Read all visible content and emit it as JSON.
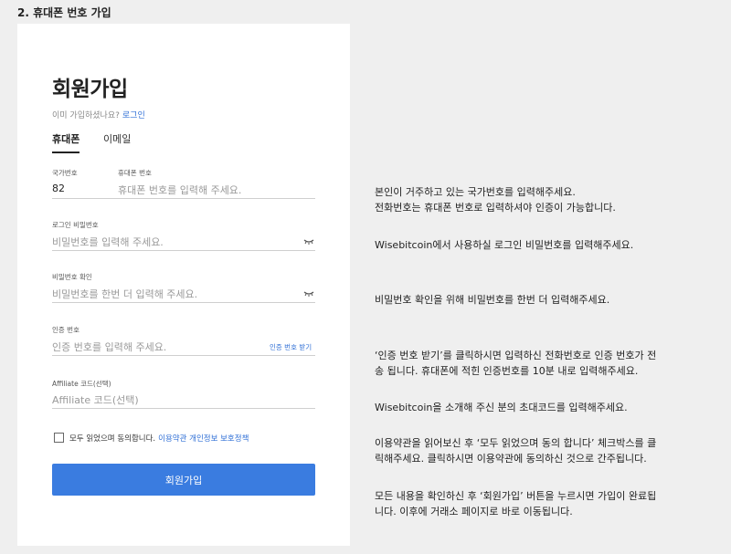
{
  "section_title": "2. 휴대폰 번호 가입",
  "form": {
    "title": "회원가입",
    "already_text": "이미 가입하셨나요?",
    "login_link": "로그인",
    "tabs": [
      {
        "label": "휴대폰",
        "active": true
      },
      {
        "label": "이메일",
        "active": false
      }
    ],
    "country_label": "국가번호",
    "country_value": "82",
    "phone_label": "휴대폰 번호",
    "phone_placeholder": "휴대폰 번호를 입력해 주세요.",
    "password_label": "로그인 비밀번호",
    "password_placeholder": "비밀번호를 입력해 주세요.",
    "password_confirm_label": "비밀번호 확인",
    "password_confirm_placeholder": "비밀번호를 한번 더 입력해 주세요.",
    "verify_label": "인증 번호",
    "verify_placeholder": "인증 번호를 입력해 주세요.",
    "verify_link": "인증 번호 받기",
    "affiliate_label": "Affiliate 코드(선택)",
    "affiliate_placeholder": "Affiliate 코드(선택)",
    "agree_text": "모두 읽었으며 동의합니다.",
    "terms_link": "이용약관 개인정보 보호정책",
    "submit_label": "회원가입"
  },
  "descriptions": {
    "country_line1": "본인이 거주하고 있는 국가번호를 입력해주세요.",
    "country_line2": "전화번호는 휴대폰 번호로 입력하셔야 인증이 가능합니다.",
    "password": "Wisebitcoin에서 사용하실 로그인 비밀번호를 입력해주세요.",
    "password_confirm": "비밀번호 확인을 위해 비밀번호를 한번 더 입력해주세요.",
    "verify_line1": "‘인증 번호 받기’를 클릭하시면 입력하신 전화번호로 인증 번호가 전",
    "verify_line2": "송 됩니다. 휴대폰에 적힌 인증번호를 10분 내로 입력해주세요.",
    "affiliate": "Wisebitcoin을 소개해 주신 분의 초대코드를 입력해주세요.",
    "terms_line1": "이용약관을 읽어보신 후 ‘모두 읽었으며 동의 합니다’ 체크박스를 클",
    "terms_line2": "릭해주세요. 클릭하시면 이용약관에 동의하신 것으로 간주됩니다.",
    "submit_line1": "모든 내용을 확인하신 후 ‘회원가입’ 버튼을 누르시면 가입이 완료됩",
    "submit_line2": "니다. 이후에 거래소 페이지로 바로 이동됩니다."
  },
  "colors": {
    "accent": "#3a7ce0",
    "link": "#2f6fd6",
    "background": "#efefef",
    "card": "#ffffff"
  },
  "icons": {
    "password_toggle": "eye-icon",
    "agree_checkbox": "checkbox-icon"
  }
}
